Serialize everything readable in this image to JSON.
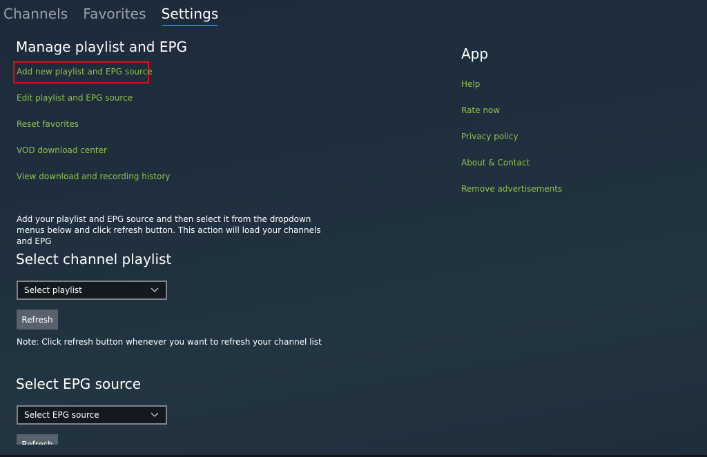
{
  "tabs": [
    {
      "label": "Channels",
      "active": false
    },
    {
      "label": "Favorites",
      "active": false
    },
    {
      "label": "Settings",
      "active": true
    }
  ],
  "manage": {
    "heading": "Manage playlist and EPG",
    "links": [
      "Add new playlist and EPG source",
      "Edit playlist and EPG source",
      "Reset favorites",
      "VOD download center",
      "View download and recording history"
    ],
    "highlighted_link_index": 0
  },
  "info_text": "Add your playlist and EPG source and then select it from the dropdown menus below and click refresh button. This action will load your channels and EPG",
  "playlist": {
    "heading": "Select channel playlist",
    "dropdown_value": "Select playlist",
    "refresh_label": "Refresh",
    "note": "Note: Click refresh button whenever you want to refresh your channel list"
  },
  "epg": {
    "heading": "Select EPG source",
    "dropdown_value": "Select EPG source",
    "refresh_label": "Refresh"
  },
  "app": {
    "heading": "App",
    "links": [
      "Help",
      "Rate now",
      "Privacy policy",
      "About & Contact",
      "Remove advertisements"
    ]
  },
  "colors": {
    "link": "#8fc24b",
    "tab_underline": "#2f7bd1",
    "highlight": "#e01010",
    "button": "#58626c"
  }
}
